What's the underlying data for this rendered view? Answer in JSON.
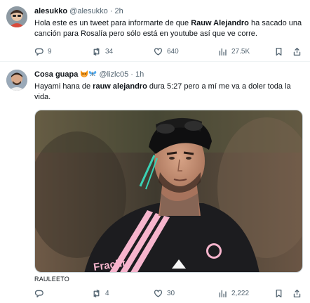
{
  "tweet1": {
    "display_name": "alesukko",
    "handle": "@alesukko",
    "separator": "·",
    "time": "2h",
    "text_parts": [
      "Hola este es un tweet para informarte de que ",
      "Rauw Alejandro",
      " ha sacado una canción para Rosalía pero sólo está en youtube así que ve corre."
    ],
    "replies": "9",
    "retweets": "34",
    "likes": "640",
    "views": "27.5K"
  },
  "tweet2": {
    "display_name": "Cosa guapa",
    "name_emojis": [
      "fox-face-emoji",
      "butterfly-emoji"
    ],
    "handle": "@lizlc05",
    "separator": "·",
    "time": "1h",
    "text_parts": [
      "Hayami hana de ",
      "rauw alejandro",
      " dura 5:27 pero a mí me va a doler toda la vida."
    ],
    "photo_credit": "RAULEETO",
    "jersey_text": "Fracht",
    "replies": "",
    "retweets": "4",
    "likes": "30",
    "views": "2,222"
  },
  "icons": [
    "reply-icon",
    "retweet-icon",
    "like-icon",
    "views-icon",
    "bookmark-icon",
    "share-icon"
  ],
  "colors": {
    "text": "#0f1419",
    "muted": "#536471",
    "divider": "#eff3f4",
    "jersey_pink": "#f7b5cd"
  }
}
